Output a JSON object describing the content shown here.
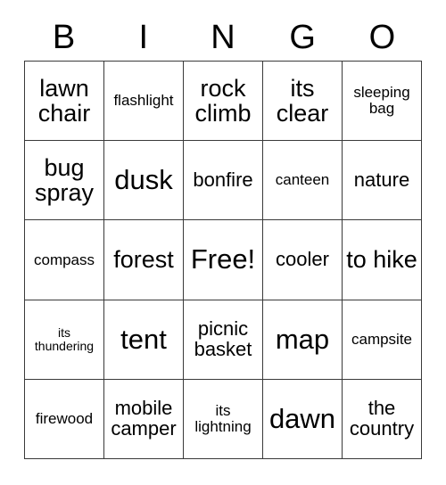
{
  "card": {
    "title": "Bingo Card",
    "header": {
      "letters": [
        "B",
        "I",
        "N",
        "G",
        "O"
      ]
    },
    "free_space_label": "Free!",
    "colors": {
      "background": "#ffffff",
      "cell_background": "#ffffff",
      "border": "#3a3a3a",
      "text": "#000000"
    },
    "grid": {
      "columns": 5,
      "rows": 5,
      "cells": [
        [
          {
            "text": "lawn chair",
            "size": "lg"
          },
          {
            "text": "flashlight",
            "size": "sm"
          },
          {
            "text": "rock climb",
            "size": "lg"
          },
          {
            "text": "its clear",
            "size": "lg"
          },
          {
            "text": "sleeping bag",
            "size": "sm"
          }
        ],
        [
          {
            "text": "bug spray",
            "size": "lg"
          },
          {
            "text": "dusk",
            "size": "xl"
          },
          {
            "text": "bonfire",
            "size": "md"
          },
          {
            "text": "canteen",
            "size": "sm"
          },
          {
            "text": "nature",
            "size": "md"
          }
        ],
        [
          {
            "text": "compass",
            "size": "sm"
          },
          {
            "text": "forest",
            "size": "lg"
          },
          {
            "text": "Free!",
            "size": "xl"
          },
          {
            "text": "cooler",
            "size": "md"
          },
          {
            "text": "to hike",
            "size": "lg"
          }
        ],
        [
          {
            "text": "its thundering",
            "size": "xs"
          },
          {
            "text": "tent",
            "size": "xl"
          },
          {
            "text": "picnic basket",
            "size": "md"
          },
          {
            "text": "map",
            "size": "xl"
          },
          {
            "text": "campsite",
            "size": "sm"
          }
        ],
        [
          {
            "text": "firewood",
            "size": "sm"
          },
          {
            "text": "mobile camper",
            "size": "md"
          },
          {
            "text": "its lightning",
            "size": "sm"
          },
          {
            "text": "dawn",
            "size": "xl"
          },
          {
            "text": "the country",
            "size": "md"
          }
        ]
      ]
    }
  }
}
